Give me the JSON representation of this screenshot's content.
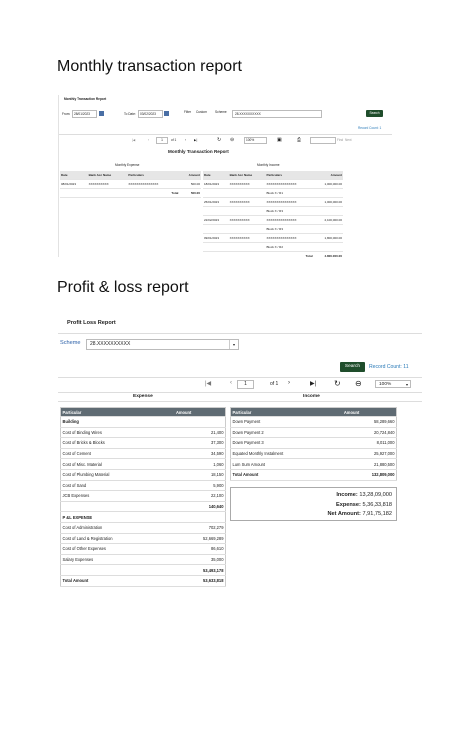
{
  "headings": {
    "monthly": "Monthly transaction report",
    "profit": "Profit & loss report"
  },
  "monthly": {
    "panel_title": "Monthly Transaction Report",
    "from_label": "From:",
    "from_value": "28/01/2023",
    "to_label": "To Date:",
    "to_value": "03/02/2023",
    "filter_label": "Filter",
    "filter_value": "Custom",
    "scheme_label": "Scheme",
    "scheme_value": "28.XXXXXXXXXX",
    "search": "Search",
    "record_count": "Record Count: 1",
    "page_value": "1",
    "of_pages": "of 1",
    "zoom": "100%",
    "find_placeholder": "Find",
    "next_label": "Next",
    "report_title": "Monthly Transaction Report",
    "expense_section": "Monthly Expense",
    "income_section": "Monthly Income",
    "columns": [
      "Date",
      "Bank Acc Name",
      "Particulars",
      "Amount"
    ],
    "expense_rows": [
      [
        "08/01/2023",
        "XXXXXXXXXX",
        "XXXXXXXXXXXXXXX",
        "500.00"
      ]
    ],
    "expense_total_label": "Total",
    "expense_total": "500.00",
    "income_rows": [
      [
        "18/01/2023",
        "XXXXXXXXXX",
        "XXXXXXXXXXXXXXX",
        "1,000,000.00"
      ],
      [
        "",
        "",
        "Block X / R1",
        ""
      ],
      [
        "25/01/2023",
        "XXXXXXXXXX",
        "XXXXXXXXXXXXXXX",
        "1,000,000.00"
      ],
      [
        "",
        "",
        "Block X / R3",
        ""
      ],
      [
        "22/02/2023",
        "XXXXXXXXXX",
        "XXXXXXXXXXXXXXX",
        "2,100,000.00"
      ],
      [
        "",
        "",
        "Block X / R3",
        ""
      ],
      [
        "09/01/2023",
        "XXXXXXXXXX",
        "XXXXXXXXXXXXXXX",
        "1,800,000.00"
      ],
      [
        "",
        "",
        "Block X / R2",
        ""
      ]
    ],
    "income_total_label": "Total",
    "income_total": "4,800,000.00"
  },
  "profit": {
    "panel_title": "Profit Loss Report",
    "scheme_label": "Scheme",
    "scheme_value": "28.XXXXXXXXXX",
    "search": "Search",
    "record_count": "Record Count: 11",
    "page_value": "1",
    "of_pages": "of 1",
    "zoom": "100%",
    "expense_title": "Expense",
    "income_title": "Income",
    "col_particular": "Particular",
    "col_amount": "Amount",
    "expense_rows": [
      {
        "p": "Building",
        "a": "",
        "bold": true
      },
      {
        "p": "Cost of Binding Wires",
        "a": "21,400"
      },
      {
        "p": "Cost of Bricks & Blocks",
        "a": "37,300"
      },
      {
        "p": "Cost of Cement",
        "a": "34,590"
      },
      {
        "p": "Cost of Misc. Material",
        "a": "1,060"
      },
      {
        "p": "Cost of Plumbing Material",
        "a": "18,150"
      },
      {
        "p": "Cost of Sand",
        "a": "5,900"
      },
      {
        "p": "JCB Expenses",
        "a": "22,100"
      },
      {
        "p": "",
        "a": "140,640",
        "bold": true
      },
      {
        "p": "P &L EXPENSE",
        "a": "",
        "bold": true
      },
      {
        "p": "Cost of Administration",
        "a": "702,279"
      },
      {
        "p": "Cost of Land & Registration",
        "a": "52,669,289"
      },
      {
        "p": "Cost of Other Expenses",
        "a": "86,610"
      },
      {
        "p": "Salary Expenses",
        "a": "35,000"
      },
      {
        "p": "",
        "a": "53,493,178",
        "bold": true
      },
      {
        "p": "Total Amount",
        "a": "53,633,818",
        "bold": true
      }
    ],
    "income_rows": [
      {
        "p": "Down Payment",
        "a": "58,289,660"
      },
      {
        "p": "Down Payment 2",
        "a": "20,724,840"
      },
      {
        "p": "Down Payment 3",
        "a": "8,011,000"
      },
      {
        "p": "Equated Monthly Instalment",
        "a": "25,927,000"
      },
      {
        "p": "Lum Sum Amount",
        "a": "21,880,500"
      },
      {
        "p": "Total Amount",
        "a": "132,809,000",
        "bold": true
      }
    ],
    "summary": [
      {
        "label": "Income:",
        "value": "13,28,09,000"
      },
      {
        "label": "Expense:",
        "value": "5,36,33,818"
      },
      {
        "label": "Net Amount:",
        "value": "7,91,75,182"
      }
    ]
  }
}
